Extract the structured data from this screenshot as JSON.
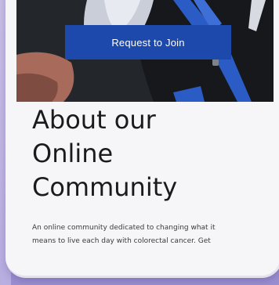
{
  "hero": {
    "join_button_label": "Request to Join"
  },
  "about": {
    "title_line_1": "About our",
    "title_line_2": "Online",
    "title_line_3": "Community",
    "description_line_1": "An online community dedicated to changing what it",
    "description_line_2": "means to live each day with colorectal cancer. Get"
  },
  "colors": {
    "button_blue": "#1d48ac",
    "background_lavender": "#a99bd6",
    "card_white": "#f6f5f7",
    "title_text": "#1b1b1f"
  }
}
